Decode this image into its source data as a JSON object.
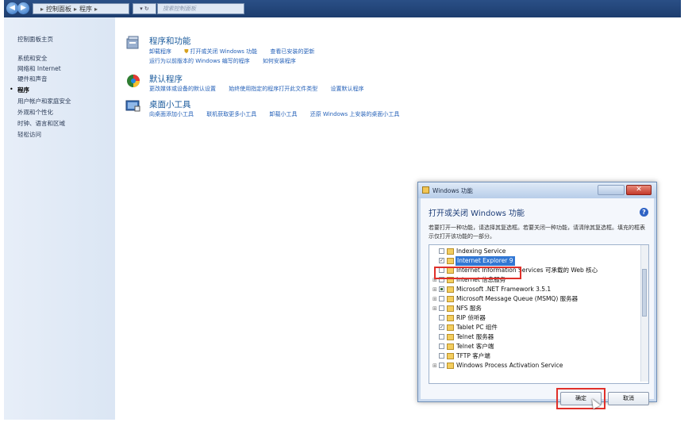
{
  "address": {
    "path": [
      "控制面板",
      "程序"
    ],
    "search_placeholder": "搜索控制面板"
  },
  "sidebar": {
    "items": [
      {
        "label": "控制面板主页",
        "active": false
      },
      {
        "label": "系统和安全",
        "active": false
      },
      {
        "label": "网络和 Internet",
        "active": false
      },
      {
        "label": "硬件和声音",
        "active": false
      },
      {
        "label": "程序",
        "active": true
      },
      {
        "label": "用户帐户和家庭安全",
        "active": false
      },
      {
        "label": "外观和个性化",
        "active": false
      },
      {
        "label": "时钟、语言和区域",
        "active": false
      },
      {
        "label": "轻松访问",
        "active": false
      }
    ]
  },
  "categories": [
    {
      "title": "程序和功能",
      "icon": "programs-features-icon",
      "links_row1": [
        "卸载程序",
        "打开或关闭 Windows 功能",
        "查看已安装的更新"
      ],
      "links_row2": [
        "运行为以前版本的 Windows 编写的程序",
        "如何安装程序"
      ]
    },
    {
      "title": "默认程序",
      "icon": "default-programs-icon",
      "links_row1": [
        "更改媒体或设备的默认设置",
        "始终使用指定的程序打开此文件类型",
        "设置默认程序"
      ]
    },
    {
      "title": "桌面小工具",
      "icon": "desktop-gadgets-icon",
      "links_row1": [
        "向桌面添加小工具",
        "联机获取更多小工具",
        "卸载小工具",
        "还原 Windows 上安装的桌面小工具"
      ]
    }
  ],
  "dialog": {
    "title": "Windows 功能",
    "heading": "打开或关闭 Windows 功能",
    "description": "若要打开一种功能，请选择其复选框。若要关闭一种功能，请清除其复选框。填充的框表示仅打开该功能的一部分。",
    "features": [
      {
        "label": "Indexing Service",
        "state": "unchecked",
        "expander": false
      },
      {
        "label": "Internet Explorer 9",
        "state": "checked",
        "expander": false,
        "selected": true
      },
      {
        "label": "Internet Information Services 可承载的 Web 核心",
        "state": "unchecked",
        "expander": false
      },
      {
        "label": "Internet 信息服务",
        "state": "unchecked",
        "expander": true
      },
      {
        "label": "Microsoft .NET Framework 3.5.1",
        "state": "partial",
        "expander": true
      },
      {
        "label": "Microsoft Message Queue (MSMQ) 服务器",
        "state": "unchecked",
        "expander": true
      },
      {
        "label": "NFS 服务",
        "state": "unchecked",
        "expander": true
      },
      {
        "label": "RIP 侦听器",
        "state": "unchecked",
        "expander": false
      },
      {
        "label": "Tablet PC 组件",
        "state": "checked",
        "expander": false
      },
      {
        "label": "Telnet 服务器",
        "state": "unchecked",
        "expander": false
      },
      {
        "label": "Telnet 客户端",
        "state": "unchecked",
        "expander": false
      },
      {
        "label": "TFTP 客户端",
        "state": "unchecked",
        "expander": false
      },
      {
        "label": "Windows Process Activation Service",
        "state": "unchecked",
        "expander": true
      }
    ],
    "ok_label": "确定",
    "cancel_label": "取消"
  },
  "colors": {
    "highlight": "#e0302a",
    "link": "#2561b8",
    "category_title": "#1a5a9c"
  }
}
